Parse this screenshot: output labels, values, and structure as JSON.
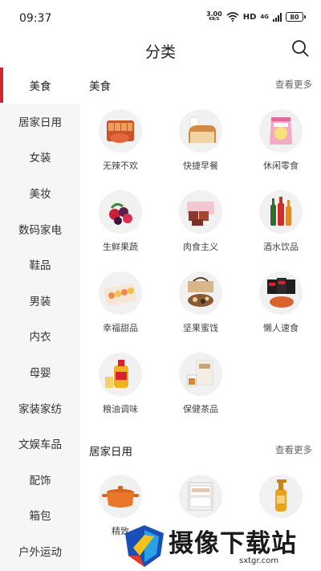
{
  "status_bar": {
    "time": "09:37",
    "net_speed": "3.00",
    "net_unit": "KB/S",
    "hd": "HD",
    "signal_type": "4G",
    "battery": "80"
  },
  "header": {
    "title": "分类",
    "search_icon": "search-icon"
  },
  "sidebar": {
    "items": [
      {
        "label": "美食",
        "active": true
      },
      {
        "label": "居家日用"
      },
      {
        "label": "女装"
      },
      {
        "label": "美妆"
      },
      {
        "label": "数码家电"
      },
      {
        "label": "鞋品"
      },
      {
        "label": "男装"
      },
      {
        "label": "内衣"
      },
      {
        "label": "母婴"
      },
      {
        "label": "家装家纺"
      },
      {
        "label": "文娱车品"
      },
      {
        "label": "配饰"
      },
      {
        "label": "箱包"
      },
      {
        "label": "户外运动"
      }
    ]
  },
  "sections": [
    {
      "title": "美食",
      "more": "查看更多",
      "items": [
        {
          "label": "无辣不欢",
          "icon": "spicy-snack"
        },
        {
          "label": "快捷早餐",
          "icon": "bread-milk"
        },
        {
          "label": "休闲零食",
          "icon": "chips-bag"
        },
        {
          "label": "生鲜果蔬",
          "icon": "berries"
        },
        {
          "label": "肉食主义",
          "icon": "meat-box"
        },
        {
          "label": "酒水饮品",
          "icon": "bottles"
        },
        {
          "label": "幸福甜品",
          "icon": "macarons"
        },
        {
          "label": "坚果蜜饯",
          "icon": "nuts-box"
        },
        {
          "label": "懒人速食",
          "icon": "noodle-packs"
        },
        {
          "label": "粮油调味",
          "icon": "oil-bottle"
        },
        {
          "label": "保健茶品",
          "icon": "tea-box"
        }
      ]
    },
    {
      "title": "居家日用",
      "more": "查看更多",
      "items": [
        {
          "label": "精致",
          "icon": "pot"
        },
        {
          "label": "",
          "icon": "drawer"
        },
        {
          "label": "",
          "icon": "shampoo"
        }
      ]
    }
  ],
  "watermark": {
    "text": "摄像下载站",
    "url": "sxtgr.com"
  }
}
